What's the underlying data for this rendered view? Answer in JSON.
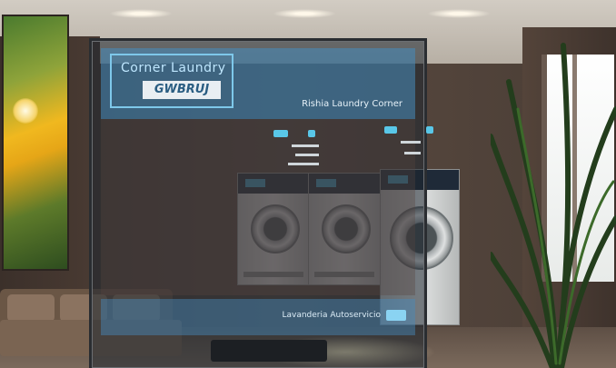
{
  "signage": {
    "brand_line1": "Corner Laundry",
    "brand_line2": "GWBRUJ",
    "header_title": "Rishia Laundry Corner",
    "footer_text": "Lavanderia Autoservicio"
  },
  "colors": {
    "panel_accent": "#468cbe",
    "display_blue": "#3aa2c9"
  },
  "scene_elements": [
    "painting",
    "washer",
    "washer",
    "washer",
    "sofa",
    "coffee-table",
    "potted-plant",
    "window"
  ]
}
